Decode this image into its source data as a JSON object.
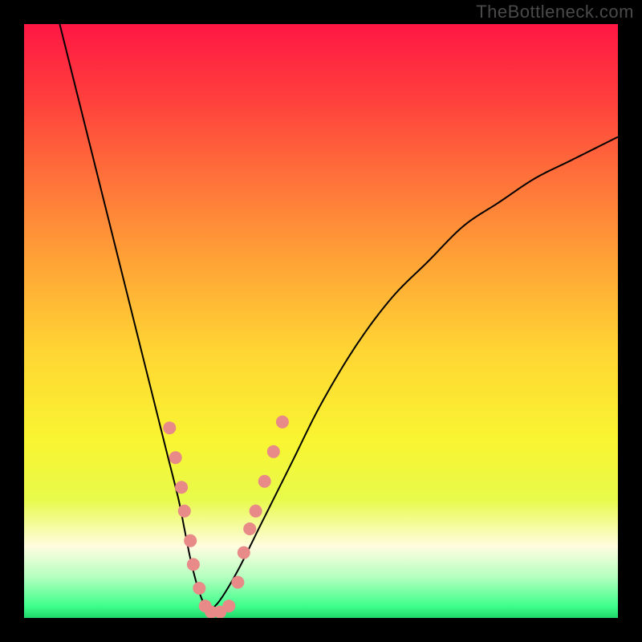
{
  "watermark": "TheBottleneck.com",
  "chart_data": {
    "type": "line",
    "title": "",
    "xlabel": "",
    "ylabel": "",
    "xlim": [
      0,
      100
    ],
    "ylim": [
      0,
      100
    ],
    "grid": false,
    "legend": false,
    "background_gradient": {
      "stops": [
        {
          "offset": 0,
          "color": "#ff1744"
        },
        {
          "offset": 0.12,
          "color": "#ff3d3d"
        },
        {
          "offset": 0.25,
          "color": "#ff6e3a"
        },
        {
          "offset": 0.4,
          "color": "#ffa336"
        },
        {
          "offset": 0.55,
          "color": "#ffd533"
        },
        {
          "offset": 0.7,
          "color": "#f9f531"
        },
        {
          "offset": 0.8,
          "color": "#e8fa4a"
        },
        {
          "offset": 0.88,
          "color": "#fffde0"
        },
        {
          "offset": 0.93,
          "color": "#b6ffc0"
        },
        {
          "offset": 0.98,
          "color": "#3fff8c"
        },
        {
          "offset": 1.0,
          "color": "#1fd66a"
        }
      ]
    },
    "series": [
      {
        "name": "left-curve",
        "x": [
          6,
          8,
          10,
          12,
          14,
          16,
          18,
          20,
          22,
          24,
          26,
          27,
          28,
          29,
          30,
          31
        ],
        "y": [
          100,
          92,
          84,
          76,
          68,
          60,
          52,
          44,
          36,
          28,
          20,
          15,
          10,
          6,
          3,
          1
        ],
        "stroke": "#000000",
        "stroke_width": 2
      },
      {
        "name": "right-curve",
        "x": [
          31,
          33,
          36,
          40,
          45,
          50,
          56,
          62,
          68,
          74,
          80,
          86,
          92,
          98,
          100
        ],
        "y": [
          1,
          3,
          8,
          16,
          26,
          36,
          46,
          54,
          60,
          66,
          70,
          74,
          77,
          80,
          81
        ],
        "stroke": "#000000",
        "stroke_width": 2
      }
    ],
    "markers": [
      {
        "comment": "pink dots clustered near the valley on both arms of the V",
        "color": "#e88a87",
        "radius_approx": 8,
        "points": [
          {
            "x": 24.5,
            "y": 32
          },
          {
            "x": 25.5,
            "y": 27
          },
          {
            "x": 26.5,
            "y": 22
          },
          {
            "x": 27.0,
            "y": 18
          },
          {
            "x": 28.0,
            "y": 13
          },
          {
            "x": 28.5,
            "y": 9
          },
          {
            "x": 29.5,
            "y": 5
          },
          {
            "x": 30.5,
            "y": 2
          },
          {
            "x": 31.5,
            "y": 1
          },
          {
            "x": 33.0,
            "y": 1
          },
          {
            "x": 34.5,
            "y": 2
          },
          {
            "x": 36.0,
            "y": 6
          },
          {
            "x": 37.0,
            "y": 11
          },
          {
            "x": 38.0,
            "y": 15
          },
          {
            "x": 39.0,
            "y": 18
          },
          {
            "x": 40.5,
            "y": 23
          },
          {
            "x": 42.0,
            "y": 28
          },
          {
            "x": 43.5,
            "y": 33
          }
        ]
      }
    ]
  }
}
